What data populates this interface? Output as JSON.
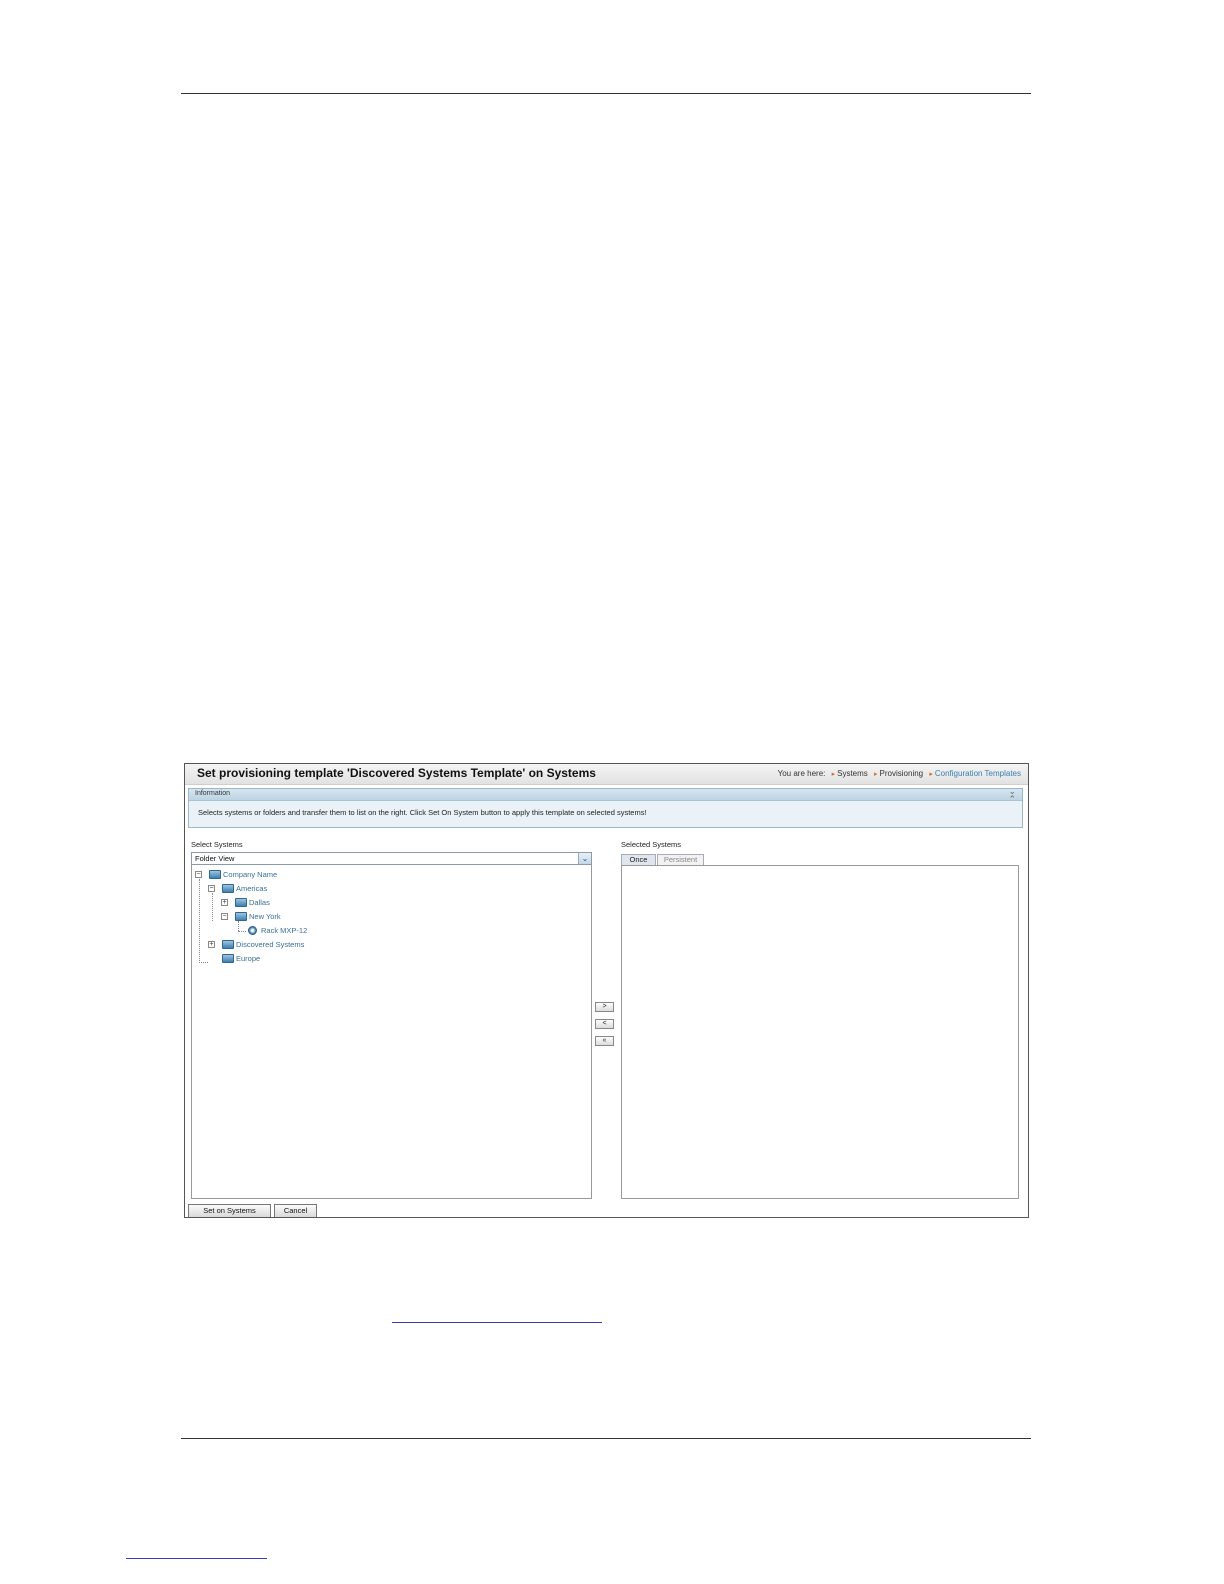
{
  "window": {
    "title": "Set provisioning template 'Discovered Systems Template' on Systems",
    "breadcrumb": {
      "prefix": "You are here:",
      "items": [
        "Systems",
        "Provisioning",
        "Configuration Templates"
      ]
    }
  },
  "information": {
    "header": "Information",
    "text": "Selects systems or folders and transfer them to list on the right. Click Set On System button to apply this template on selected systems!"
  },
  "select_systems": {
    "label": "Select Systems",
    "view_select": "Folder View",
    "tree": [
      {
        "label": "Company Name",
        "toggle": "−",
        "icon": "folder-icon"
      },
      {
        "label": "Americas",
        "toggle": "−",
        "icon": "folder-icon"
      },
      {
        "label": "Dallas",
        "toggle": "+",
        "icon": "folder-icon"
      },
      {
        "label": "New York",
        "toggle": "−",
        "icon": "folder-icon"
      },
      {
        "label": "Rack MXP-12",
        "toggle": "",
        "icon": "device-icon"
      },
      {
        "label": "Discovered Systems",
        "toggle": "+",
        "icon": "folder-icon"
      },
      {
        "label": "Europe",
        "toggle": "",
        "icon": "folder-icon"
      }
    ]
  },
  "movers": {
    "add": ">",
    "remove": "<",
    "remove_all": "«"
  },
  "selected_systems": {
    "label": "Selected Systems",
    "tabs": [
      "Once",
      "Persistent"
    ]
  },
  "buttons": {
    "set_on_systems": "Set on Systems",
    "cancel": "Cancel"
  },
  "colors": {
    "link": "#3a6f95",
    "breadcrumb_arrow": "#d07030",
    "info_background": "#eaf2f7"
  }
}
